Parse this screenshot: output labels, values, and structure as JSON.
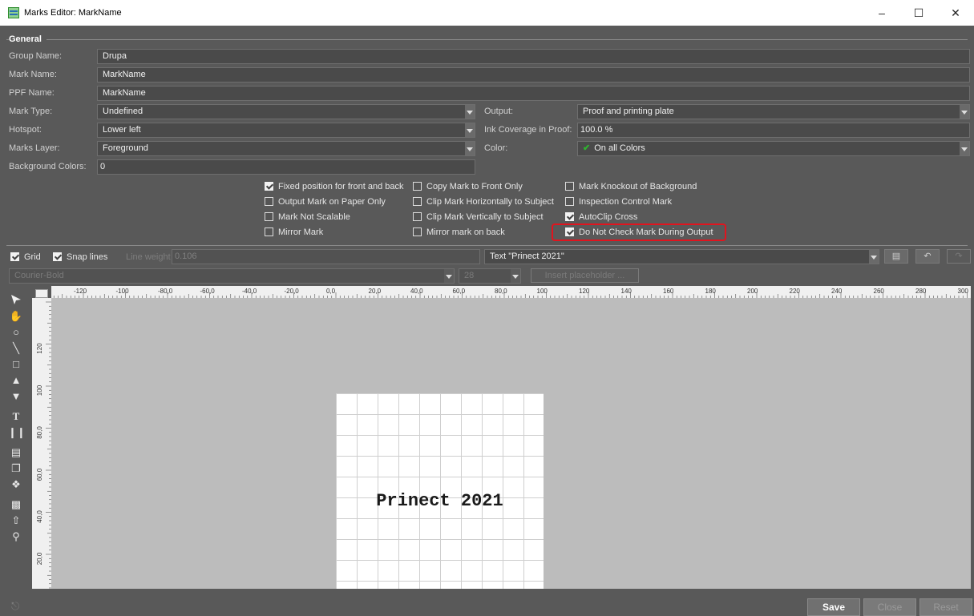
{
  "window": {
    "title": "Marks Editor: MarkName"
  },
  "general": {
    "heading": "General",
    "group_name": {
      "label": "Group Name:",
      "value": "Drupa"
    },
    "mark_name": {
      "label": "Mark Name:",
      "value": "MarkName"
    },
    "ppf_name": {
      "label": "PPF Name:",
      "value": "MarkName"
    },
    "mark_type": {
      "label": "Mark Type:",
      "value": "Undefined"
    },
    "hotspot": {
      "label": "Hotspot:",
      "value": "Lower left"
    },
    "marks_layer": {
      "label": "Marks Layer:",
      "value": "Foreground"
    },
    "background_colors": {
      "label": "Background Colors:",
      "value": "0"
    },
    "output": {
      "label": "Output:",
      "value": "Proof and printing plate"
    },
    "ink_coverage": {
      "label": "Ink Coverage in Proof:",
      "value": "100.0 %"
    },
    "color": {
      "label": "Color:",
      "value": "On all Colors"
    }
  },
  "options": {
    "col1": [
      {
        "label": "Fixed position for front and back",
        "checked": true
      },
      {
        "label": "Output Mark on Paper Only",
        "checked": false
      },
      {
        "label": "Mark Not Scalable",
        "checked": false
      },
      {
        "label": "Mirror Mark",
        "checked": false
      }
    ],
    "col2": [
      {
        "label": "Copy Mark to Front Only",
        "checked": false
      },
      {
        "label": "Clip Mark Horizontally to Subject",
        "checked": false
      },
      {
        "label": "Clip Mark Vertically to Subject",
        "checked": false
      },
      {
        "label": "Mirror mark on back",
        "checked": false
      }
    ],
    "col3": [
      {
        "label": "Mark Knockout of Background",
        "checked": false
      },
      {
        "label": "Inspection Control Mark",
        "checked": false
      },
      {
        "label": "AutoClip Cross",
        "checked": true
      },
      {
        "label": "Do Not Check Mark During Output",
        "checked": true
      }
    ]
  },
  "toolbar": {
    "grid": {
      "label": "Grid",
      "checked": true
    },
    "snap_lines": {
      "label": "Snap lines",
      "checked": true
    },
    "line_weight_label": "Line weight",
    "line_weight_value": "0.106",
    "object_select": "Text \"Prinect 2021\"",
    "font": "Courier-Bold",
    "font_size": "28",
    "insert_placeholder": "Insert placeholder ..."
  },
  "ruler": {
    "h_labels": [
      "-120",
      "-100",
      "-80,0",
      "-60,0",
      "-40,0",
      "-20,0",
      "0,0",
      "20,0",
      "40,0",
      "60,0",
      "80,0",
      "100",
      "120",
      "140",
      "160",
      "180",
      "200",
      "220",
      "240",
      "260",
      "280",
      "300"
    ],
    "v_labels": [
      "120",
      "100",
      "80,0",
      "60,0",
      "40,0",
      "20,0"
    ]
  },
  "canvas": {
    "mark_text": "Prinect 2021"
  },
  "buttons": {
    "save": "Save",
    "close": "Close",
    "reset": "Reset"
  }
}
